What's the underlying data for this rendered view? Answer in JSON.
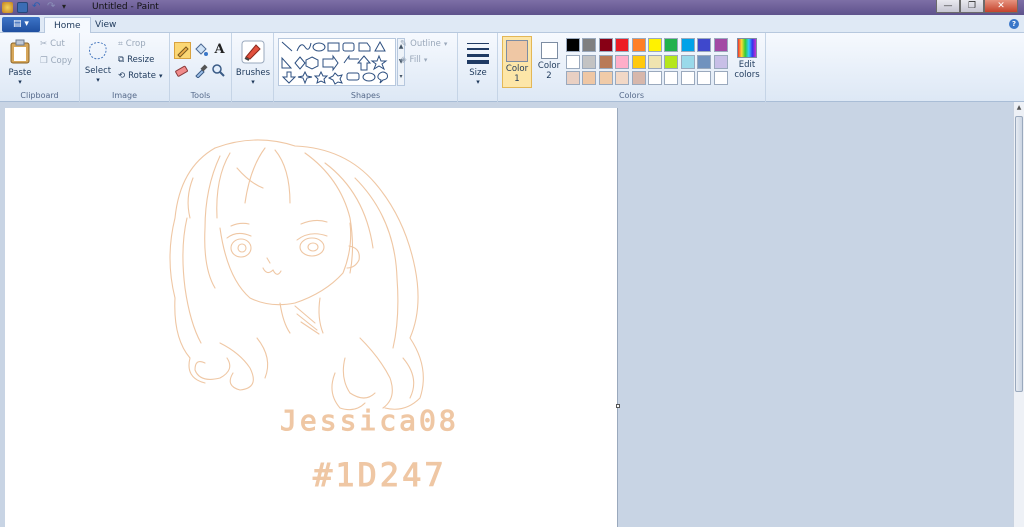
{
  "window": {
    "title": "Untitled - Paint",
    "minimize": "—",
    "restore": "❐",
    "close": "✕"
  },
  "tabs": {
    "file": "▤ ▾",
    "home": "Home",
    "view": "View",
    "help": "?"
  },
  "clipboard": {
    "label": "Clipboard",
    "paste": "Paste",
    "cut": "Cut",
    "copy": "Copy"
  },
  "image": {
    "label": "Image",
    "select": "Select",
    "crop": "Crop",
    "resize": "Resize",
    "rotate": "Rotate"
  },
  "tools": {
    "label": "Tools"
  },
  "brushes": {
    "label": "Brushes"
  },
  "shapes": {
    "label": "Shapes",
    "outline": "Outline",
    "fill": "Fill"
  },
  "size": {
    "label": "Size"
  },
  "colors": {
    "label": "Colors",
    "color1": "Color 1",
    "color1_num": "1",
    "color2": "Color 2",
    "color2_num": "2",
    "edit": "Edit colors",
    "color1_value": "#efc7a4",
    "color2_value": "#ffffff",
    "palette_row1": [
      "#000000",
      "#7f7f7f",
      "#880015",
      "#ed1c24",
      "#ff7f27",
      "#fff200",
      "#22b14c",
      "#00a2e8",
      "#3f48cc",
      "#a349a4"
    ],
    "palette_row2": [
      "#ffffff",
      "#c3c3c3",
      "#b97a57",
      "#ffaec9",
      "#ffc90e",
      "#efe4b0",
      "#b5e61d",
      "#99d9ea",
      "#7092be",
      "#c8bfe7"
    ],
    "palette_row3": [
      "#e9d0c3",
      "#efc7a4",
      "#f0cba8",
      "#f2d8c6",
      "#d7b7ab",
      "#ffffff",
      "#ffffff",
      "#ffffff",
      "#ffffff",
      "#ffffff"
    ]
  },
  "drawing": {
    "stroke_color": "#efc7a4",
    "signature": "Jessica08",
    "tag": "#1D247"
  }
}
